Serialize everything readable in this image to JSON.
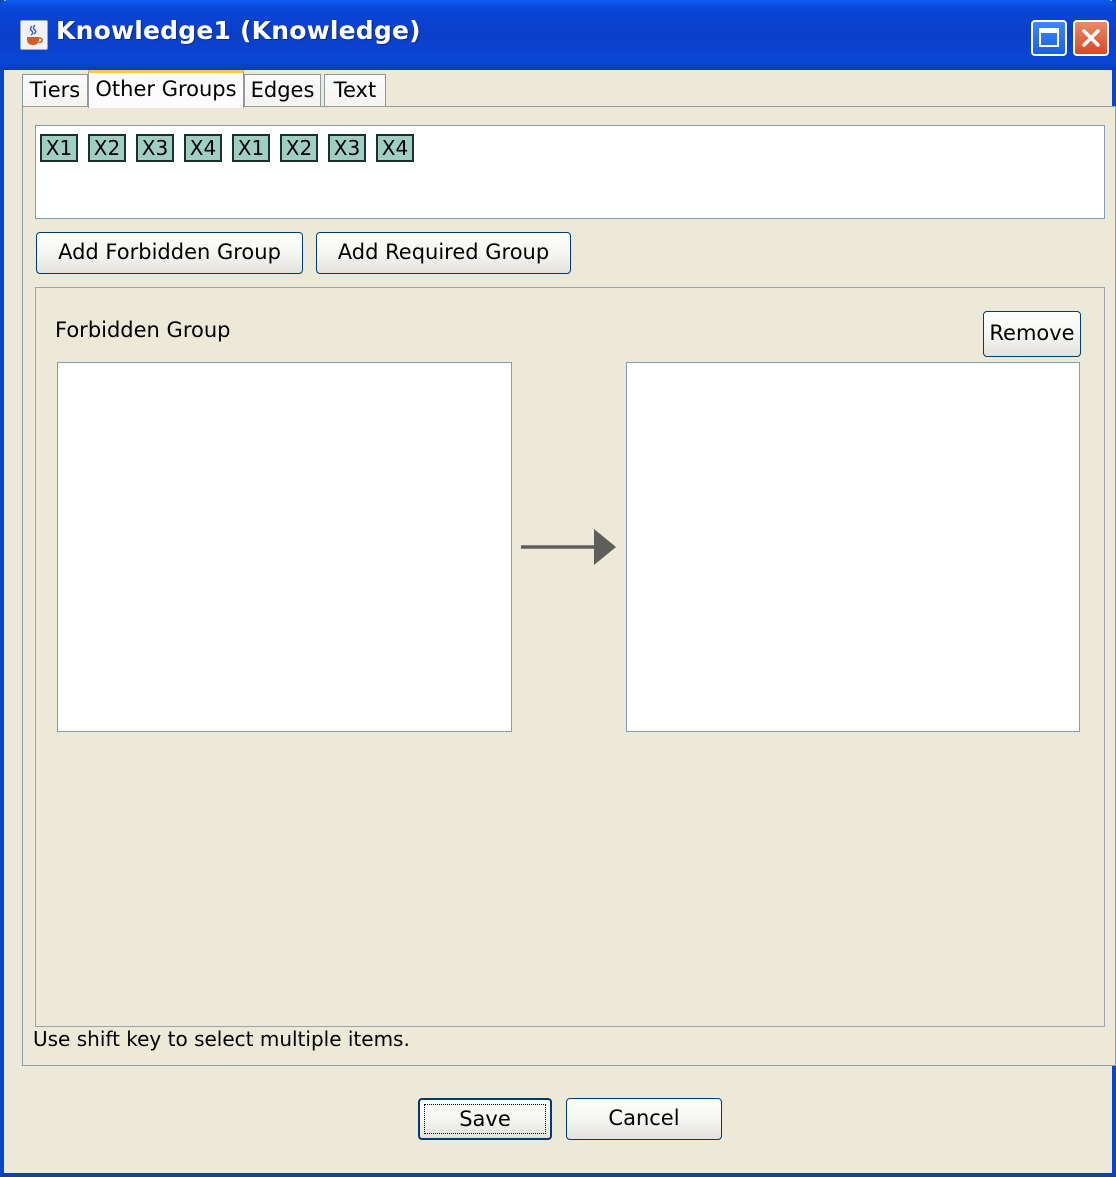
{
  "window": {
    "title": "Knowledge1 (Knowledge)"
  },
  "tabs": [
    {
      "label": "Tiers",
      "active": false
    },
    {
      "label": "Other Groups",
      "active": true
    },
    {
      "label": "Edges",
      "active": false
    },
    {
      "label": "Text",
      "active": false
    }
  ],
  "variables": [
    "X1",
    "X2",
    "X3",
    "X4",
    "X1",
    "X2",
    "X3",
    "X4"
  ],
  "actions": {
    "add_forbidden": "Add Forbidden Group",
    "add_required": "Add Required Group"
  },
  "group": {
    "title": "Forbidden Group",
    "remove_label": "Remove"
  },
  "hint": "Use shift key to select multiple items.",
  "footer": {
    "save_label": "Save",
    "cancel_label": "Cancel"
  },
  "colors": {
    "titlebar": "#0a46d8",
    "chip": "#9fcfc3",
    "dialog_bg": "#ece9d8",
    "tab_accent": "#ffc83c"
  },
  "icons": {
    "window": "java-cup-icon",
    "maximize": "maximize-icon",
    "close": "close-icon",
    "arrow": "right-arrow-icon"
  }
}
